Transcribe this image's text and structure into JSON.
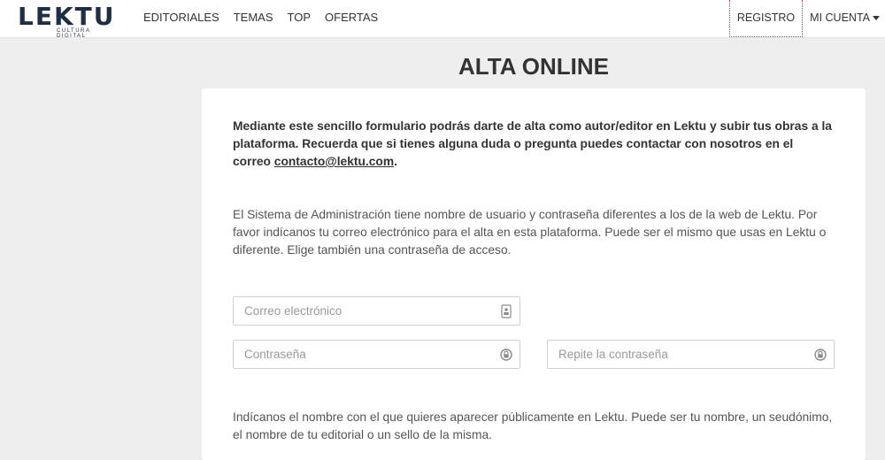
{
  "brand": {
    "name": "LEKTU",
    "tagline": "CULTURA DIGITAL",
    "color": "#1e2e45"
  },
  "nav": {
    "links": [
      "EDITORIALES",
      "TEMAS",
      "TOP",
      "OFERTAS"
    ],
    "registro": "REGISTRO",
    "mi_cuenta": "MI CUENTA"
  },
  "page": {
    "title": "ALTA ONLINE"
  },
  "form": {
    "intro_text": "Mediante este sencillo formulario podrás darte de alta como autor/editor en Lektu y subir tus obras a la plataforma. Recuerda que si tienes alguna duda o pregunta puedes contactar con nosotros en el correo ",
    "contact_email": "contacto@lektu.com",
    "intro_end": ".",
    "info_text": "El Sistema de Administración tiene nombre de usuario y contraseña diferentes a los de la web de Lektu. Por favor indícanos tu correo electrónico para el alta en esta plataforma. Puede ser el mismo que usas en Lektu o diferente. Elige también una contraseña de acceso.",
    "email_placeholder": "Correo electrónico",
    "password_placeholder": "Contraseña",
    "repeat_password_placeholder": "Repite la contraseña",
    "name_text": "Indícanos el nombre con el que quieres aparecer públicamente en Lektu. Puede ser tu nombre, un seudónimo, el nombre de tu editorial o un sello de la misma."
  },
  "icons": {
    "email_field": "contact-card-icon",
    "password_field": "lock-icon"
  }
}
